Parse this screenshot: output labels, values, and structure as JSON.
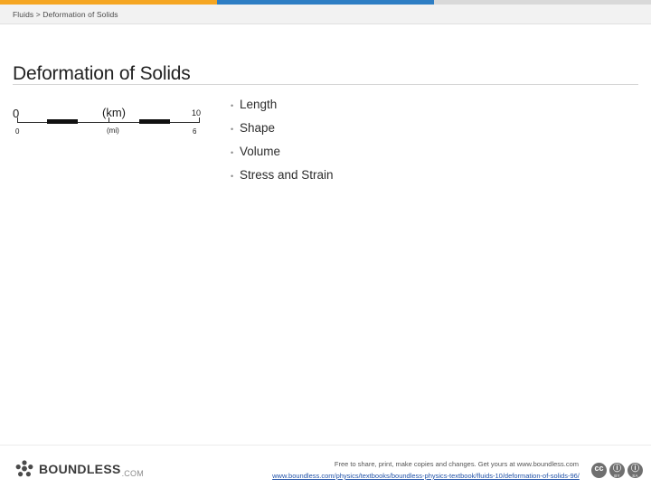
{
  "topbar": {
    "segment_colors": [
      "#f5a623",
      "#2e7ec4",
      "#d9d9d9"
    ]
  },
  "breadcrumb": {
    "text": "Fluids > Deformation of Solids"
  },
  "page": {
    "title": "Deformation of Solids"
  },
  "scale_figure": {
    "km_min": "0",
    "km_unit": "(km)",
    "km_max": "10",
    "mi_min": "0",
    "mi_unit": "(mi)",
    "mi_max": "6"
  },
  "bullets": [
    {
      "mark": "•",
      "label": "Length"
    },
    {
      "mark": "•",
      "label": "Shape"
    },
    {
      "mark": "•",
      "label": "Volume"
    },
    {
      "mark": "•",
      "label": "Stress and Strain"
    }
  ],
  "footer": {
    "note": "Free to share, print, make copies and changes. Get yours at www.boundless.com",
    "link": "www.boundless.com/physics/textbooks/boundless-physics-textbook/fluids-10/deformation-of-solids-96/",
    "logo_word": "BOUNDLESS",
    "logo_dotcom": ".COM",
    "cc_badges": [
      {
        "glyph": "cc",
        "sub": ""
      },
      {
        "glyph": "ⓘ",
        "sub": "BY"
      },
      {
        "glyph": "ⓘ",
        "sub": "SA"
      }
    ]
  }
}
